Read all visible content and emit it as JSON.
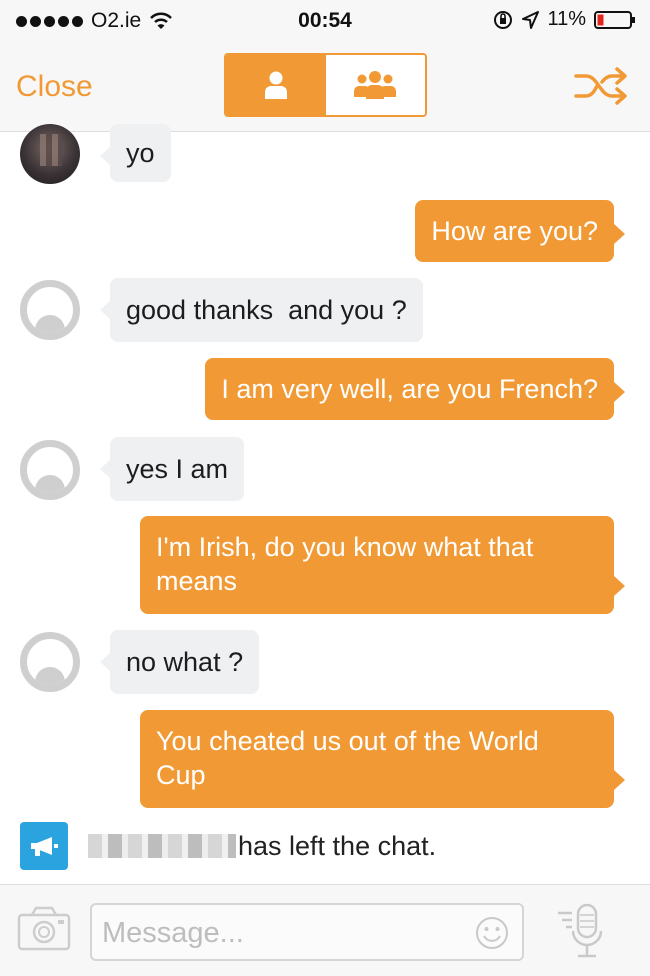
{
  "status_bar": {
    "carrier": "O2.ie",
    "time": "00:54",
    "battery": "11%"
  },
  "nav": {
    "close_label": "Close",
    "segments": [
      {
        "icon": "person-icon",
        "active": true
      },
      {
        "icon": "group-icon",
        "active": false
      }
    ],
    "shuffle_icon": "shuffle-icon"
  },
  "messages": [
    {
      "direction": "in",
      "text": "yo",
      "avatar": "photo"
    },
    {
      "direction": "out",
      "text": "How are you?"
    },
    {
      "direction": "in",
      "text": "good thanks  and you ?",
      "avatar": "generic"
    },
    {
      "direction": "out",
      "text": "I am very well, are you French?"
    },
    {
      "direction": "in",
      "text": "yes I am",
      "avatar": "generic"
    },
    {
      "direction": "out",
      "lines": [
        "I'm Irish, do you know what that",
        "means"
      ]
    },
    {
      "direction": "in",
      "text": "no what ?",
      "avatar": "generic"
    },
    {
      "direction": "out",
      "lines": [
        "You cheated us out of the World",
        "Cup"
      ]
    }
  ],
  "system_notice": {
    "text": "has left the chat.",
    "icon": "megaphone-icon"
  },
  "input": {
    "placeholder": "Message..."
  },
  "colors": {
    "accent": "#f19a35",
    "incoming_bubble": "#eef0f2",
    "notice_icon_bg": "#2aa3de"
  }
}
